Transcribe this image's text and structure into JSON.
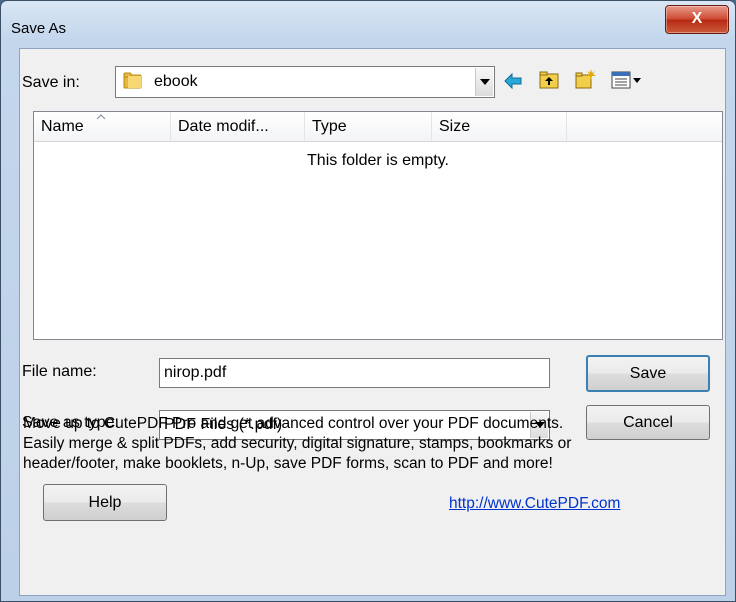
{
  "window": {
    "title": "Save As",
    "close_label": "X"
  },
  "save_in": {
    "label": "Save in:",
    "value": "ebook"
  },
  "toolbar": {
    "icons": [
      "back-arrow-icon",
      "up-folder-icon",
      "new-folder-icon",
      "view-menu-icon"
    ]
  },
  "file_list": {
    "columns": [
      "Name",
      "Date modif...",
      "Type",
      "Size"
    ],
    "empty_message": "This folder is empty."
  },
  "file_name": {
    "label": "File name:",
    "value": "nirop.pdf"
  },
  "save_as_type": {
    "label": "Save as type:",
    "value": "PDF Files (*.pdf)"
  },
  "buttons": {
    "save": "Save",
    "cancel": "Cancel",
    "help": "Help"
  },
  "promo": {
    "line1": "Move up to CutePDF Pro and get advanced control over your PDF documents.",
    "line2": "Easily merge & split PDFs, add security, digital signature, stamps, bookmarks or",
    "line3": "header/footer, make booklets, n-Up, save PDF forms, scan to PDF and more!",
    "link": "http://www.CutePDF.com"
  },
  "colors": {
    "close_button": "#c9472f",
    "link": "#0033cc",
    "folder": "#e8b83a",
    "back_arrow": "#2aa7d8"
  }
}
